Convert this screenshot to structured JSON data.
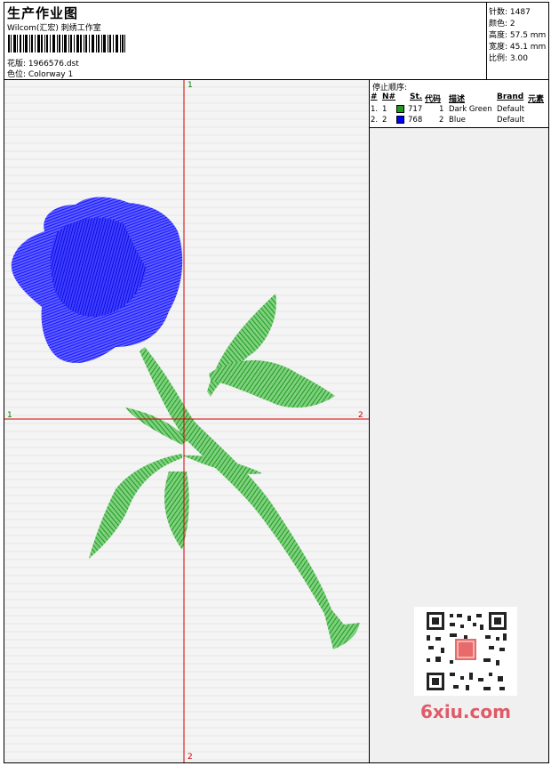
{
  "header": {
    "title": "生产作业图",
    "subtitle": "Wilcom(汇宏) 刺绣工作室",
    "design_file": "花版: 1966576.dst",
    "colorway": "色位: Colorway 1"
  },
  "stats": {
    "stitches": "针数: 1487",
    "colors": "颜色: 2",
    "height": "高度: 57.5 mm",
    "width": "宽度: 45.1 mm",
    "scale": "比例: 3.00"
  },
  "legend": {
    "title": "停止顺序:",
    "columns": {
      "num": "#",
      "n": "N#",
      "st": "St.",
      "code": "代码",
      "desc": "描述",
      "brand": "Brand",
      "elem": "元素"
    },
    "rows": [
      {
        "num": "1.",
        "n": "1",
        "color": "#1e9b1e",
        "st": "717",
        "code": "1",
        "desc": "Dark Green",
        "brand": "Default"
      },
      {
        "num": "2.",
        "n": "2",
        "color": "#0000ff",
        "st": "768",
        "code": "2",
        "desc": "Blue",
        "brand": "Default"
      }
    ]
  },
  "axes": {
    "top": "1",
    "bottom": "2",
    "left": "1",
    "right": "2"
  },
  "colors": {
    "thread_green": "#1e9b1e",
    "thread_blue": "#0000ff",
    "axis_red": "#d00000"
  },
  "watermark": {
    "qr": "qr-code-icon",
    "text": "6xiu.com"
  }
}
